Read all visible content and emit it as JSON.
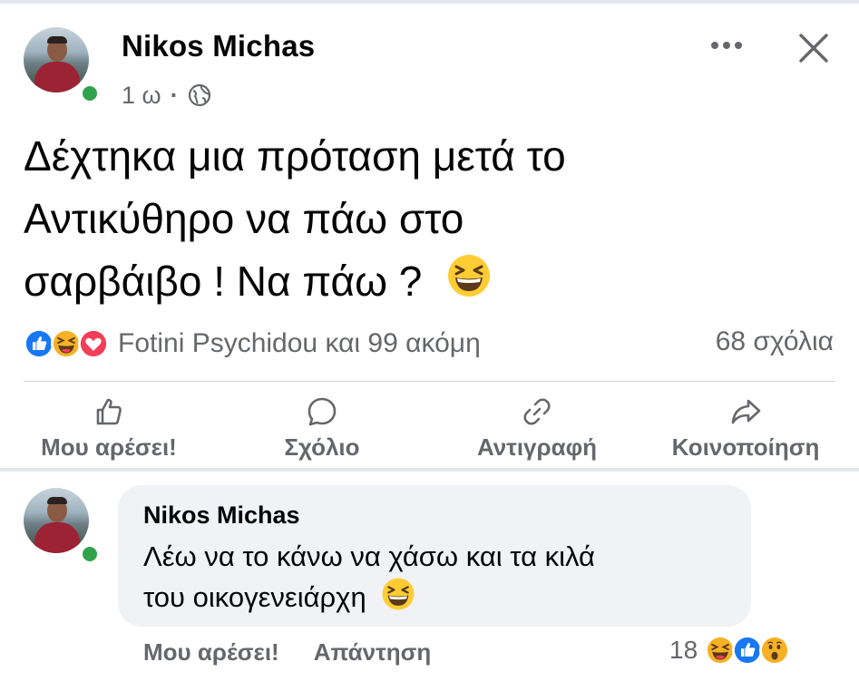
{
  "post": {
    "author": "Nikos Michas",
    "time": "1 ω",
    "separator": "·",
    "audience_icon": "globe-icon",
    "text_lines": [
      "Δέχτηκα μια πρόταση μετά το",
      "Αντικύθηρο να πάω στο",
      "σαρβάιβο ! Να πάω ?"
    ],
    "text_emoji": "laughing-squinting-face-emoji"
  },
  "reactions": {
    "icons": [
      "like-reaction-icon",
      "haha-reaction-icon",
      "love-reaction-icon"
    ],
    "names": "Fotini Psychidou και 99 ακόμη",
    "comments": "68 σχόλια"
  },
  "actions": {
    "like": "Μου αρέσει!",
    "comment": "Σχόλιο",
    "copy": "Αντιγραφή",
    "share": "Κοινοποίηση"
  },
  "comment": {
    "author": "Nikos Michas",
    "text_lines": [
      "Λέω να το κάνω να χάσω και τα κιλά",
      "του οικογενειάρχη"
    ],
    "text_emoji": "laughing-squinting-face-emoji",
    "like_label": "Μου αρέσει!",
    "reply_label": "Απάντηση",
    "reaction_count": "18",
    "reaction_icons": [
      "haha-reaction-icon",
      "like-reaction-icon",
      "wow-reaction-icon"
    ]
  },
  "colors": {
    "text": "#050505",
    "secondary": "#65676b",
    "online": "#31a24c",
    "like_blue": "#1877f2",
    "love_red": "#f33e58",
    "haha_yellow": "#f7b125",
    "bubble_bg": "#f0f2f5"
  }
}
